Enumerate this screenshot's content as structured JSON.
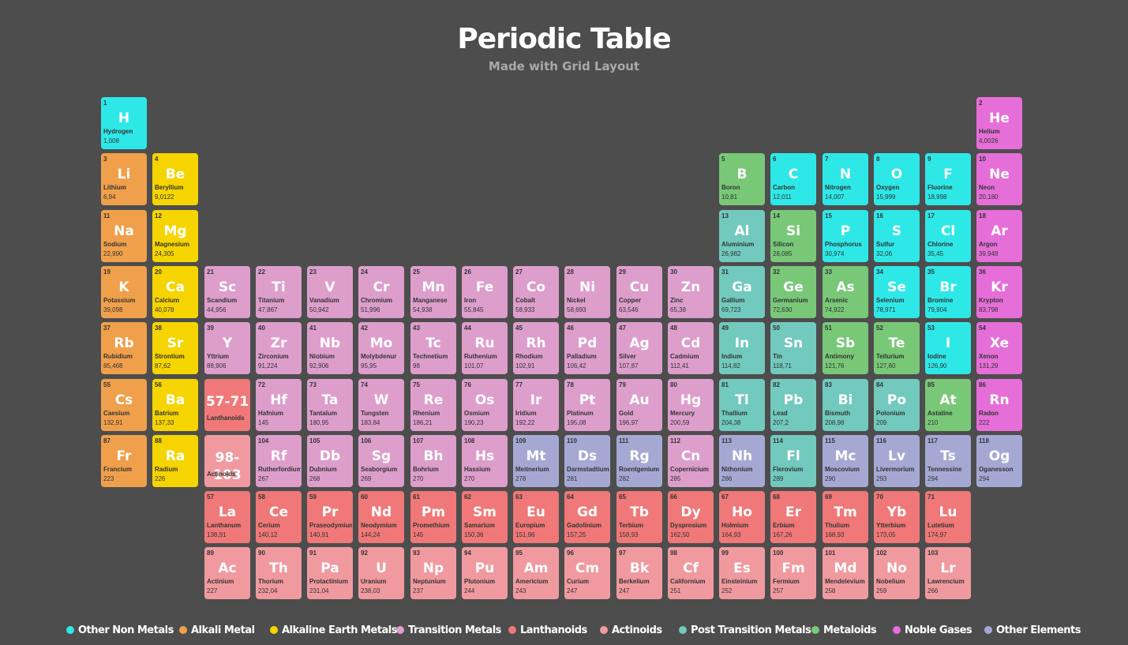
{
  "header": {
    "title": "Periodic Table",
    "subtitle": "Made with Grid Layout"
  },
  "colors": {
    "nonmetal": "#2ee8e8",
    "alkali": "#f0a04b",
    "alkaline": "#f5d400",
    "transition": "#dd9ecc",
    "lanthanoid": "#f07878",
    "actinoid": "#f09aa0",
    "post": "#72c9bd",
    "metalloid": "#78c878",
    "noble": "#e66ed8",
    "other": "#a6a8d4"
  },
  "elements": [
    {
      "n": "1",
      "s": "H",
      "name": "Hydrogen",
      "m": "1,008",
      "c": "nonmetal"
    },
    {
      "n": "2",
      "s": "He",
      "name": "Helium",
      "m": "4,0026",
      "c": "noble"
    },
    {
      "n": "3",
      "s": "Li",
      "name": "Lithium",
      "m": "6,94",
      "c": "alkali"
    },
    {
      "n": "4",
      "s": "Be",
      "name": "Beryllium",
      "m": "9,0122",
      "c": "alkaline"
    },
    {
      "n": "5",
      "s": "B",
      "name": "Boron",
      "m": "10,81",
      "c": "metalloid"
    },
    {
      "n": "6",
      "s": "C",
      "name": "Carbon",
      "m": "12,011",
      "c": "nonmetal"
    },
    {
      "n": "7",
      "s": "N",
      "name": "Nitrogen",
      "m": "14,007",
      "c": "nonmetal"
    },
    {
      "n": "8",
      "s": "O",
      "name": "Oxygen",
      "m": "15,999",
      "c": "nonmetal"
    },
    {
      "n": "9",
      "s": "F",
      "name": "Fluorine",
      "m": "18,998",
      "c": "nonmetal"
    },
    {
      "n": "10",
      "s": "Ne",
      "name": "Neon",
      "m": "20,180",
      "c": "noble"
    },
    {
      "n": "11",
      "s": "Na",
      "name": "Sodium",
      "m": "22,990",
      "c": "alkali"
    },
    {
      "n": "12",
      "s": "Mg",
      "name": "Magnesium",
      "m": "24,305",
      "c": "alkaline"
    },
    {
      "n": "13",
      "s": "Al",
      "name": "Aluminium",
      "m": "26,982",
      "c": "post"
    },
    {
      "n": "14",
      "s": "Si",
      "name": "Silicon",
      "m": "28,085",
      "c": "metalloid"
    },
    {
      "n": "15",
      "s": "P",
      "name": "Phosphorus",
      "m": "30,974",
      "c": "nonmetal"
    },
    {
      "n": "16",
      "s": "S",
      "name": "Sulfur",
      "m": "32,06",
      "c": "nonmetal"
    },
    {
      "n": "17",
      "s": "Cl",
      "name": "Chlorine",
      "m": "35,45",
      "c": "nonmetal"
    },
    {
      "n": "18",
      "s": "Ar",
      "name": "Argon",
      "m": "39,948",
      "c": "noble"
    },
    {
      "n": "19",
      "s": "K",
      "name": "Potassium",
      "m": "39,098",
      "c": "alkali"
    },
    {
      "n": "20",
      "s": "Ca",
      "name": "Calcium",
      "m": "40,078",
      "c": "alkaline"
    },
    {
      "n": "21",
      "s": "Sc",
      "name": "Scandium",
      "m": "44,956",
      "c": "transition"
    },
    {
      "n": "22",
      "s": "Ti",
      "name": "Titanium",
      "m": "47,867",
      "c": "transition"
    },
    {
      "n": "23",
      "s": "V",
      "name": "Vanadium",
      "m": "50,942",
      "c": "transition"
    },
    {
      "n": "24",
      "s": "Cr",
      "name": "Chromium",
      "m": "51,996",
      "c": "transition"
    },
    {
      "n": "25",
      "s": "Mn",
      "name": "Manganese",
      "m": "54,938",
      "c": "transition"
    },
    {
      "n": "26",
      "s": "Fe",
      "name": "Iron",
      "m": "55,845",
      "c": "transition"
    },
    {
      "n": "27",
      "s": "Co",
      "name": "Cobalt",
      "m": "58,933",
      "c": "transition"
    },
    {
      "n": "28",
      "s": "Ni",
      "name": "Nickel",
      "m": "58,693",
      "c": "transition"
    },
    {
      "n": "29",
      "s": "Cu",
      "name": "Copper",
      "m": "63,546",
      "c": "transition"
    },
    {
      "n": "30",
      "s": "Zn",
      "name": "Zinc",
      "m": "65,38",
      "c": "transition"
    },
    {
      "n": "31",
      "s": "Ga",
      "name": "Gallium",
      "m": "69,723",
      "c": "post"
    },
    {
      "n": "32",
      "s": "Ge",
      "name": "Germanium",
      "m": "72,630",
      "c": "metalloid"
    },
    {
      "n": "33",
      "s": "As",
      "name": "Arsenic",
      "m": "74,922",
      "c": "metalloid"
    },
    {
      "n": "34",
      "s": "Se",
      "name": "Selenium",
      "m": "78,971",
      "c": "nonmetal"
    },
    {
      "n": "35",
      "s": "Br",
      "name": "Bromine",
      "m": "79,904",
      "c": "nonmetal"
    },
    {
      "n": "36",
      "s": "Kr",
      "name": "Krypton",
      "m": "83,798",
      "c": "noble"
    },
    {
      "n": "37",
      "s": "Rb",
      "name": "Rubidium",
      "m": "85,468",
      "c": "alkali"
    },
    {
      "n": "38",
      "s": "Sr",
      "name": "Strontium",
      "m": "87,62",
      "c": "alkaline"
    },
    {
      "n": "39",
      "s": "Y",
      "name": "Yttrium",
      "m": "88,906",
      "c": "transition"
    },
    {
      "n": "40",
      "s": "Zr",
      "name": "Zirconium",
      "m": "91,224",
      "c": "transition"
    },
    {
      "n": "41",
      "s": "Nb",
      "name": "Niobium",
      "m": "92,906",
      "c": "transition"
    },
    {
      "n": "42",
      "s": "Mo",
      "name": "Molybdenur",
      "m": "95,95",
      "c": "transition"
    },
    {
      "n": "43",
      "s": "Tc",
      "name": "Technetium",
      "m": "98",
      "c": "transition"
    },
    {
      "n": "44",
      "s": "Ru",
      "name": "Ruthenium",
      "m": "101,07",
      "c": "transition"
    },
    {
      "n": "45",
      "s": "Rh",
      "name": "Rhodium",
      "m": "102,91",
      "c": "transition"
    },
    {
      "n": "46",
      "s": "Pd",
      "name": "Palladium",
      "m": "106,42",
      "c": "transition"
    },
    {
      "n": "47",
      "s": "Ag",
      "name": "Silver",
      "m": "107,87",
      "c": "transition"
    },
    {
      "n": "48",
      "s": "Cd",
      "name": "Cadmium",
      "m": "112,41",
      "c": "transition"
    },
    {
      "n": "49",
      "s": "In",
      "name": "Indium",
      "m": "114,82",
      "c": "post"
    },
    {
      "n": "50",
      "s": "Sn",
      "name": "Tin",
      "m": "118,71",
      "c": "post"
    },
    {
      "n": "51",
      "s": "Sb",
      "name": "Antimony",
      "m": "121,76",
      "c": "metalloid"
    },
    {
      "n": "52",
      "s": "Te",
      "name": "Tellurium",
      "m": "127,60",
      "c": "metalloid"
    },
    {
      "n": "53",
      "s": "I",
      "name": "Iodine",
      "m": "126,90",
      "c": "nonmetal"
    },
    {
      "n": "54",
      "s": "Xe",
      "name": "Xenon",
      "m": "131,29",
      "c": "noble"
    },
    {
      "n": "55",
      "s": "Cs",
      "name": "Caesium",
      "m": "132,91",
      "c": "alkali"
    },
    {
      "n": "56",
      "s": "Ba",
      "name": "Batrium",
      "m": "137,33",
      "c": "alkaline"
    },
    {
      "n": "",
      "s": "57-71",
      "name": "Lanthanoids",
      "m": "",
      "c": "lanthanoid",
      "range": true
    },
    {
      "n": "72",
      "s": "Hf",
      "name": "Hafnium",
      "m": "145",
      "c": "transition"
    },
    {
      "n": "73",
      "s": "Ta",
      "name": "Tantalum",
      "m": "180,95",
      "c": "transition"
    },
    {
      "n": "74",
      "s": "W",
      "name": "Tungsten",
      "m": "183,84",
      "c": "transition"
    },
    {
      "n": "75",
      "s": "Re",
      "name": "Rhenium",
      "m": "186,21",
      "c": "transition"
    },
    {
      "n": "76",
      "s": "Os",
      "name": "Osmium",
      "m": "190,23",
      "c": "transition"
    },
    {
      "n": "77",
      "s": "Ir",
      "name": "Iridium",
      "m": "192,22",
      "c": "transition"
    },
    {
      "n": "78",
      "s": "Pt",
      "name": "Platinum",
      "m": "195,08",
      "c": "transition"
    },
    {
      "n": "79",
      "s": "Au",
      "name": "Gold",
      "m": "196,97",
      "c": "transition"
    },
    {
      "n": "80",
      "s": "Hg",
      "name": "Mercury",
      "m": "200,59",
      "c": "transition"
    },
    {
      "n": "81",
      "s": "Tl",
      "name": "Thallium",
      "m": "204,38",
      "c": "post"
    },
    {
      "n": "82",
      "s": "Pb",
      "name": "Lead",
      "m": "207,2",
      "c": "post"
    },
    {
      "n": "83",
      "s": "Bi",
      "name": "Bismuth",
      "m": "208,98",
      "c": "post"
    },
    {
      "n": "84",
      "s": "Po",
      "name": "Polonium",
      "m": "209",
      "c": "post"
    },
    {
      "n": "85",
      "s": "At",
      "name": "Astatine",
      "m": "210",
      "c": "metalloid"
    },
    {
      "n": "86",
      "s": "Rn",
      "name": "Radon",
      "m": "222",
      "c": "noble"
    },
    {
      "n": "87",
      "s": "Fr",
      "name": "Francium",
      "m": "223",
      "c": "alkali"
    },
    {
      "n": "88",
      "s": "Ra",
      "name": "Radium",
      "m": "226",
      "c": "alkaline"
    },
    {
      "n": "",
      "s": "98-103",
      "name": "Actinoids",
      "m": "",
      "c": "actinoid",
      "range": true
    },
    {
      "n": "104",
      "s": "Rf",
      "name": "Rutherfordium",
      "m": "267",
      "c": "transition"
    },
    {
      "n": "105",
      "s": "Db",
      "name": "Dubnium",
      "m": "268",
      "c": "transition"
    },
    {
      "n": "106",
      "s": "Sg",
      "name": "Seaborgium",
      "m": "269",
      "c": "transition"
    },
    {
      "n": "107",
      "s": "Bh",
      "name": "Bohrium",
      "m": "270",
      "c": "transition"
    },
    {
      "n": "108",
      "s": "Hs",
      "name": "Hassium",
      "m": "270",
      "c": "transition"
    },
    {
      "n": "109",
      "s": "Mt",
      "name": "Meitnerium",
      "m": "278",
      "c": "other"
    },
    {
      "n": "110",
      "s": "Ds",
      "name": "Darmstadtium",
      "m": "281",
      "c": "other"
    },
    {
      "n": "111",
      "s": "Rg",
      "name": "Roentgenium",
      "m": "282",
      "c": "other"
    },
    {
      "n": "112",
      "s": "Cn",
      "name": "Copernicium",
      "m": "285",
      "c": "transition"
    },
    {
      "n": "113",
      "s": "Nh",
      "name": "Nithonium",
      "m": "286",
      "c": "other"
    },
    {
      "n": "114",
      "s": "Fl",
      "name": "Flerovium",
      "m": "289",
      "c": "post"
    },
    {
      "n": "115",
      "s": "Mc",
      "name": "Moscovium",
      "m": "290",
      "c": "other"
    },
    {
      "n": "116",
      "s": "Lv",
      "name": "Livermorium",
      "m": "293",
      "c": "other"
    },
    {
      "n": "117",
      "s": "Ts",
      "name": "Tennessine",
      "m": "294",
      "c": "other"
    },
    {
      "n": "118",
      "s": "Og",
      "name": "Oganesson",
      "m": "294",
      "c": "other"
    },
    {
      "n": "57",
      "s": "La",
      "name": "Lanthanum",
      "m": "138,91",
      "c": "lanthanoid"
    },
    {
      "n": "58",
      "s": "Ce",
      "name": "Cerium",
      "m": "140,12",
      "c": "lanthanoid"
    },
    {
      "n": "59",
      "s": "Pr",
      "name": "Praseodymium",
      "m": "140,91",
      "c": "lanthanoid"
    },
    {
      "n": "60",
      "s": "Nd",
      "name": "Neodymium",
      "m": "144,24",
      "c": "lanthanoid"
    },
    {
      "n": "61",
      "s": "Pm",
      "name": "Promethium",
      "m": "145",
      "c": "lanthanoid"
    },
    {
      "n": "62",
      "s": "Sm",
      "name": "Samarium",
      "m": "150,36",
      "c": "lanthanoid"
    },
    {
      "n": "63",
      "s": "Eu",
      "name": "Europium",
      "m": "151,96",
      "c": "lanthanoid"
    },
    {
      "n": "64",
      "s": "Gd",
      "name": "Gadolinium",
      "m": "157,25",
      "c": "lanthanoid"
    },
    {
      "n": "65",
      "s": "Tb",
      "name": "Terbium",
      "m": "158,93",
      "c": "lanthanoid"
    },
    {
      "n": "66",
      "s": "Dy",
      "name": "Dysprosium",
      "m": "162,50",
      "c": "lanthanoid"
    },
    {
      "n": "67",
      "s": "Ho",
      "name": "Holmium",
      "m": "164,93",
      "c": "lanthanoid"
    },
    {
      "n": "68",
      "s": "Er",
      "name": "Erbium",
      "m": "167,26",
      "c": "lanthanoid"
    },
    {
      "n": "69",
      "s": "Tm",
      "name": "Thulium",
      "m": "168,93",
      "c": "lanthanoid"
    },
    {
      "n": "70",
      "s": "Yb",
      "name": "Ytterbium",
      "m": "173,05",
      "c": "lanthanoid"
    },
    {
      "n": "71",
      "s": "Lu",
      "name": "Lutetium",
      "m": "174,97",
      "c": "lanthanoid"
    },
    {
      "n": "89",
      "s": "Ac",
      "name": "Actinium",
      "m": "227",
      "c": "actinoid"
    },
    {
      "n": "90",
      "s": "Th",
      "name": "Thorium",
      "m": "232,04",
      "c": "actinoid"
    },
    {
      "n": "91",
      "s": "Pa",
      "name": "Protactinium",
      "m": "231,04",
      "c": "actinoid"
    },
    {
      "n": "92",
      "s": "U",
      "name": "Uranium",
      "m": "238,03",
      "c": "actinoid"
    },
    {
      "n": "93",
      "s": "Np",
      "name": "Neptunium",
      "m": "237",
      "c": "actinoid"
    },
    {
      "n": "94",
      "s": "Pu",
      "name": "Plutonium",
      "m": "244",
      "c": "actinoid"
    },
    {
      "n": "95",
      "s": "Am",
      "name": "Americium",
      "m": "243",
      "c": "actinoid"
    },
    {
      "n": "96",
      "s": "Cm",
      "name": "Curium",
      "m": "247",
      "c": "actinoid"
    },
    {
      "n": "97",
      "s": "Bk",
      "name": "Berkelium",
      "m": "247",
      "c": "actinoid"
    },
    {
      "n": "98",
      "s": "Cf",
      "name": "Californium",
      "m": "251",
      "c": "actinoid"
    },
    {
      "n": "99",
      "s": "Es",
      "name": "Einsteinium",
      "m": "252",
      "c": "actinoid"
    },
    {
      "n": "100",
      "s": "Fm",
      "name": "Fermium",
      "m": "257",
      "c": "actinoid"
    },
    {
      "n": "101",
      "s": "Md",
      "name": "Mendelevium",
      "m": "258",
      "c": "actinoid"
    },
    {
      "n": "102",
      "s": "No",
      "name": "Nobelium",
      "m": "259",
      "c": "actinoid"
    },
    {
      "n": "103",
      "s": "Lr",
      "name": "Lawrencium",
      "m": "266",
      "c": "actinoid"
    }
  ],
  "legend": [
    {
      "label": "Other Non Metals",
      "c": "nonmetal"
    },
    {
      "label": "Alkali Metal",
      "c": "alkali"
    },
    {
      "label": "Alkaline Earth Metals",
      "c": "alkaline"
    },
    {
      "label": "Transition Metals",
      "c": "transition"
    },
    {
      "label": "Lanthanoids",
      "c": "lanthanoid"
    },
    {
      "label": "Actinoids",
      "c": "actinoid"
    },
    {
      "label": "Post Transition Metals",
      "c": "post"
    },
    {
      "label": "Metaloids",
      "c": "metalloid"
    },
    {
      "label": "Noble Gases",
      "c": "noble"
    },
    {
      "label": "Other Elements",
      "c": "other"
    }
  ]
}
